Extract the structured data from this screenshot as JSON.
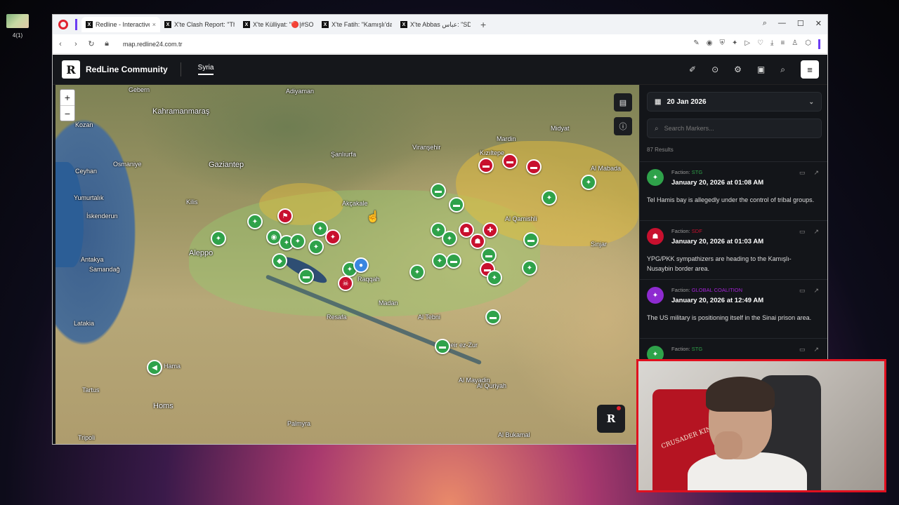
{
  "desktop": {
    "icon_label": "4(1)"
  },
  "browser": {
    "tabs": [
      {
        "fav": "X",
        "title": "Redline - Interactive Strat",
        "active": true
      },
      {
        "fav": "X",
        "title": "X'te Clash Report: \"The Sy"
      },
      {
        "fav": "X",
        "title": "X'te Külliyat: \"🔴|#SONDA"
      },
      {
        "fav": "X",
        "title": "X'te Fatih: \"Kamışlı'da top"
      },
      {
        "fav": "X",
        "title": "X'te Abbas عباس: \"SDF's ."
      }
    ],
    "new_tab": "+",
    "url": "map.redline24.com.tr"
  },
  "app": {
    "brand": "RedLine Community",
    "logo": "R",
    "region_tab": "Syria",
    "header_icons": [
      "edit-pin-icon",
      "location-pin-icon",
      "gear-icon",
      "camera-icon",
      "search-icon",
      "menu-icon"
    ]
  },
  "map": {
    "zoom_in": "+",
    "zoom_out": "−",
    "r_button": "R",
    "cities": [
      {
        "name": "Adiyaman"
      },
      {
        "name": "Kahramanmaraş"
      },
      {
        "name": "Gaziantep"
      },
      {
        "name": "Şanlıurfa"
      },
      {
        "name": "Mardin"
      },
      {
        "name": "Midyat"
      },
      {
        "name": "Aleppo"
      },
      {
        "name": "Raqqah"
      },
      {
        "name": "Latakia"
      },
      {
        "name": "Hama"
      },
      {
        "name": "Homs"
      },
      {
        "name": "Tartus"
      },
      {
        "name": "Tripoli"
      },
      {
        "name": "İskenderun"
      },
      {
        "name": "Osmaniye"
      },
      {
        "name": "Kilis"
      },
      {
        "name": "Akçakale"
      },
      {
        "name": "Viranşehir"
      },
      {
        "name": "Kızıltepe"
      },
      {
        "name": "Al Mabada"
      },
      {
        "name": "Palmyra"
      },
      {
        "name": "Sinjar"
      },
      {
        "name": "Al Qamishli"
      },
      {
        "name": "Al Mayadin"
      },
      {
        "name": "Al Quriyah"
      },
      {
        "name": "Al Bukamal"
      },
      {
        "name": "Gebern"
      },
      {
        "name": "Kozan"
      },
      {
        "name": "Ceyhan"
      },
      {
        "name": "Yumurtalık"
      },
      {
        "name": "Antakya"
      },
      {
        "name": "Samandağ"
      },
      {
        "name": "Madan"
      },
      {
        "name": "Al Tebni"
      },
      {
        "name": "Resafa"
      },
      {
        "name": "Deir ez-Zur"
      }
    ]
  },
  "sidebar": {
    "date": "20 Jan 2026",
    "search_placeholder": "Search Markers...",
    "results": "87 Results",
    "entries": [
      {
        "faction_label": "Faction:",
        "faction": "STG",
        "faction_color": "#2fa24a",
        "icon_color": "#2fa24a",
        "time": "January 20, 2026 at 01:08 AM",
        "text": "Tel Hamis bay is allegedly under the control of tribal groups."
      },
      {
        "faction_label": "Faction:",
        "faction": "SDF",
        "faction_color": "#c8102e",
        "icon_color": "#c8102e",
        "time": "January 20, 2026 at 01:03 AM",
        "text": "YPG/PKK sympathizers are heading to the Kamışlı-Nusaybin border area."
      },
      {
        "faction_label": "Faction:",
        "faction": "GLOBAL COALITION",
        "faction_color": "#a323d6",
        "icon_color": "#8e2bd0",
        "time": "January 20, 2026 at 12:49 AM",
        "text": "The US military is positioning itself in the Sinai prison area."
      },
      {
        "faction_label": "Faction:",
        "faction": "STG",
        "faction_color": "#2fa24a",
        "icon_color": "#2fa24a",
        "time": "",
        "text": ""
      }
    ]
  },
  "webcam": {
    "chair_text": "CRUSADER KINGS III"
  }
}
